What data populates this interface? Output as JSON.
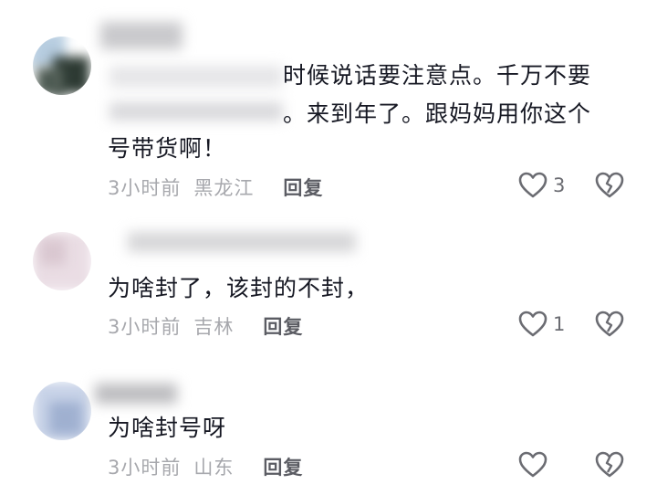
{
  "comments": [
    {
      "text_line1": "时候说话要注意点。千万不要",
      "text_line2": "。来到年了。跟妈妈用你这个",
      "text_line3": "号带货啊！",
      "time": "3小时前",
      "location": "黑龙江",
      "reply_label": "回复",
      "like_count": "3"
    },
    {
      "text": "为啥封了，该封的不封，",
      "time": "3小时前",
      "location": "吉林",
      "reply_label": "回复",
      "like_count": "1"
    },
    {
      "text": "为啥封号呀",
      "time": "3小时前",
      "location": "山东",
      "reply_label": "回复",
      "like_count": ""
    }
  ],
  "icons": {
    "like": "heart-outline-icon",
    "dislike": "broken-heart-icon"
  },
  "colors": {
    "text": "#161823",
    "meta": "#a7a8ad",
    "icon": "#6b6c72"
  }
}
